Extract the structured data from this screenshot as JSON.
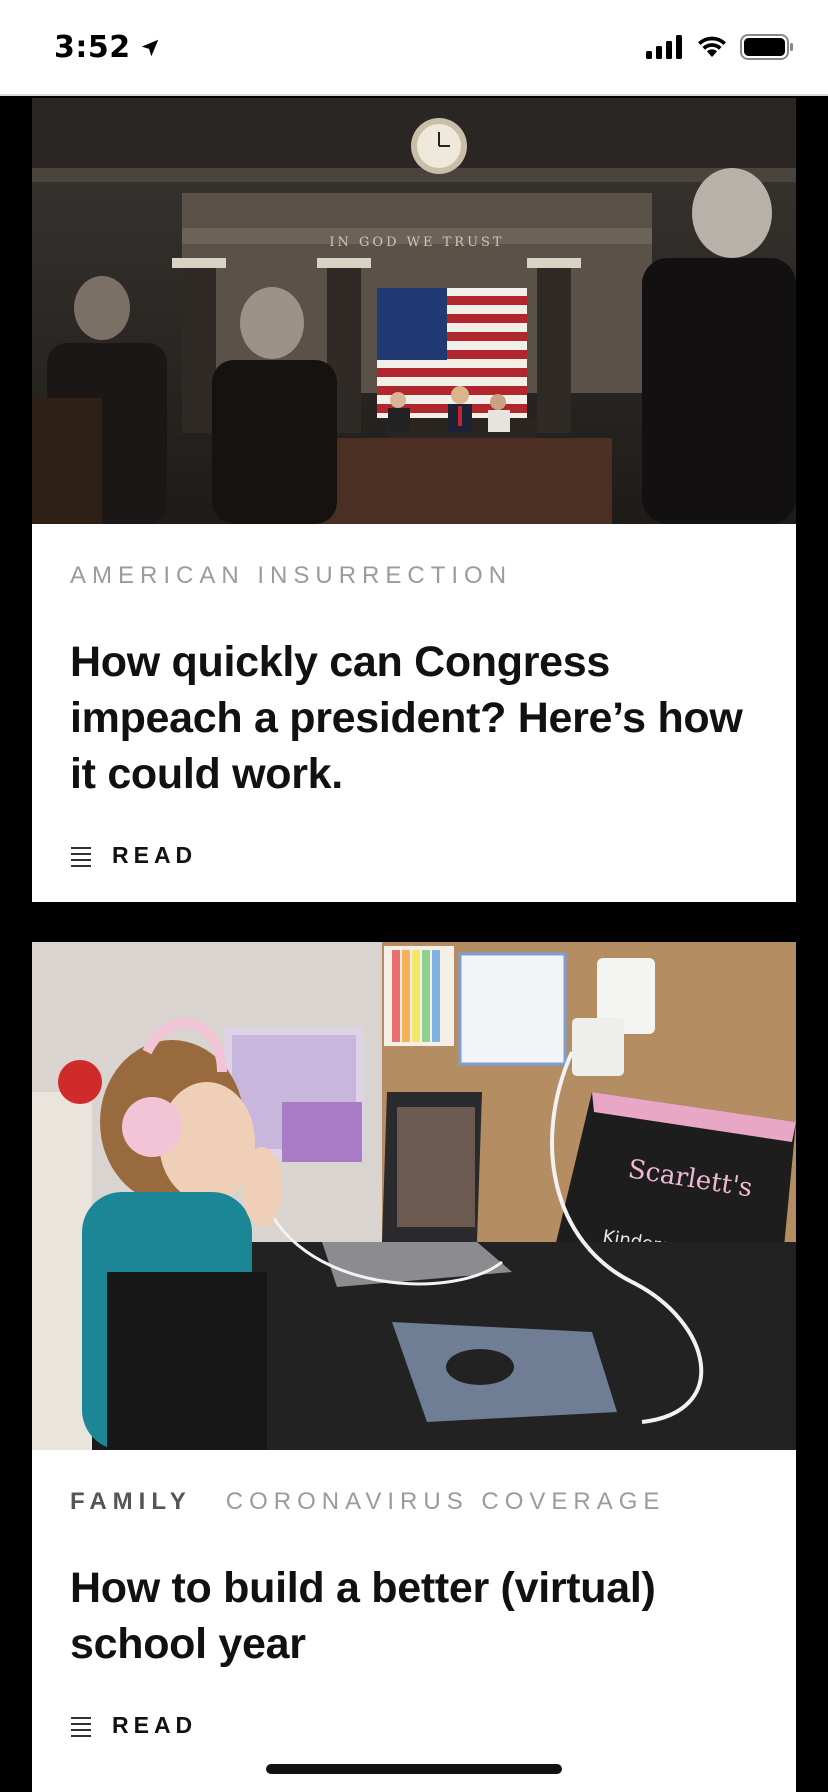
{
  "status_bar": {
    "time": "3:52",
    "icons": [
      "location-arrow-icon",
      "cellular-signal-icon",
      "wifi-icon",
      "battery-icon"
    ]
  },
  "feed": {
    "articles": [
      {
        "tags": [
          "AMERICAN INSURRECTION"
        ],
        "headline": "How quickly can Congress impeach a president? Here’s how it could work.",
        "read_label": "READ",
        "image": "photo-house-chamber-address"
      },
      {
        "tags": [
          "FAMILY",
          "CORONAVIRUS COVERAGE"
        ],
        "headline": "How to build a better (virtual) school year",
        "read_label": "READ",
        "image": "photo-child-virtual-school-desk"
      }
    ]
  },
  "colors": {
    "page_background": "#000000",
    "card_background": "#ffffff",
    "tag_muted": "#9b9b9b",
    "tag_strong": "#555555",
    "headline": "#111111"
  }
}
